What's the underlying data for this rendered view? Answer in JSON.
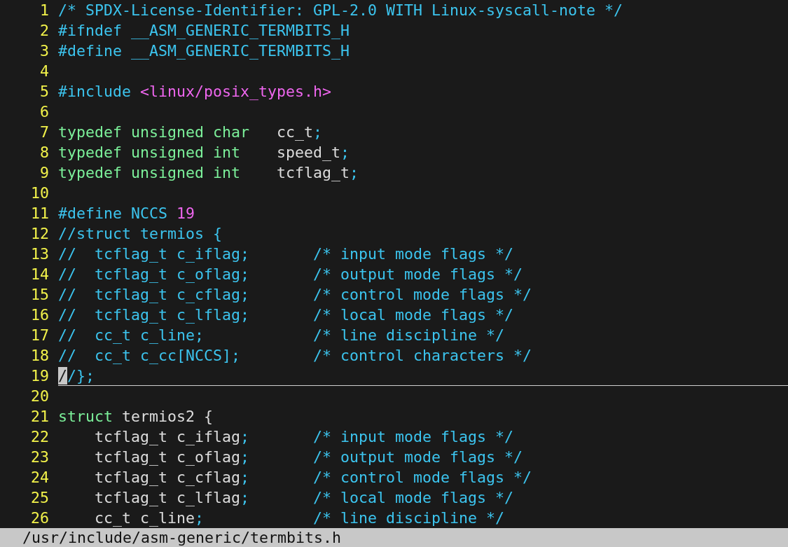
{
  "editor": {
    "lines": [
      {
        "number": "1",
        "current": false,
        "tokens": [
          {
            "kind": "comment",
            "text": "/* SPDX-License-Identifier: GPL-2.0 WITH Linux-syscall-note */"
          }
        ]
      },
      {
        "number": "2",
        "current": false,
        "tokens": [
          {
            "kind": "preproc",
            "text": "#ifndef __ASM_GENERIC_TERMBITS_H"
          }
        ]
      },
      {
        "number": "3",
        "current": false,
        "tokens": [
          {
            "kind": "preproc",
            "text": "#define __ASM_GENERIC_TERMBITS_H"
          }
        ]
      },
      {
        "number": "4",
        "current": false
      },
      {
        "number": "5",
        "current": false,
        "tokens": [
          {
            "kind": "preproc",
            "text": "#include "
          },
          {
            "kind": "string",
            "text": "<linux/posix_types.h>"
          }
        ]
      },
      {
        "number": "6",
        "current": false
      },
      {
        "number": "7",
        "current": false,
        "tokens": [
          {
            "kind": "type",
            "text": "typedef unsigned char"
          },
          {
            "kind": "plain",
            "text": "   cc_t"
          },
          {
            "kind": "punct",
            "text": ";"
          }
        ]
      },
      {
        "number": "8",
        "current": false,
        "tokens": [
          {
            "kind": "type",
            "text": "typedef unsigned int"
          },
          {
            "kind": "plain",
            "text": "    speed_t"
          },
          {
            "kind": "punct",
            "text": ";"
          }
        ]
      },
      {
        "number": "9",
        "current": false,
        "tokens": [
          {
            "kind": "type",
            "text": "typedef unsigned int"
          },
          {
            "kind": "plain",
            "text": "    tcflag_t"
          },
          {
            "kind": "punct",
            "text": ";"
          }
        ]
      },
      {
        "number": "10",
        "current": false
      },
      {
        "number": "11",
        "current": false,
        "tokens": [
          {
            "kind": "preproc",
            "text": "#define NCCS "
          },
          {
            "kind": "number",
            "text": "19"
          }
        ]
      },
      {
        "number": "12",
        "current": false,
        "tokens": [
          {
            "kind": "comment",
            "text": "//struct termios {"
          }
        ]
      },
      {
        "number": "13",
        "current": false,
        "tokens": [
          {
            "kind": "comment",
            "text": "//  tcflag_t c_iflag;       /* input mode flags */"
          }
        ]
      },
      {
        "number": "14",
        "current": false,
        "tokens": [
          {
            "kind": "comment",
            "text": "//  tcflag_t c_oflag;       /* output mode flags */"
          }
        ]
      },
      {
        "number": "15",
        "current": false,
        "tokens": [
          {
            "kind": "comment",
            "text": "//  tcflag_t c_cflag;       /* control mode flags */"
          }
        ]
      },
      {
        "number": "16",
        "current": false,
        "tokens": [
          {
            "kind": "comment",
            "text": "//  tcflag_t c_lflag;       /* local mode flags */"
          }
        ]
      },
      {
        "number": "17",
        "current": false,
        "tokens": [
          {
            "kind": "comment",
            "text": "//  cc_t c_line;            /* line discipline */"
          }
        ]
      },
      {
        "number": "18",
        "current": false,
        "tokens": [
          {
            "kind": "comment",
            "text": "//  cc_t c_cc[NCCS];        /* control characters */"
          }
        ]
      },
      {
        "number": "19",
        "current": true,
        "tokens": [
          {
            "kind": "cursor",
            "text": "/"
          },
          {
            "kind": "comment",
            "text": "/};"
          }
        ]
      },
      {
        "number": "20",
        "current": false
      },
      {
        "number": "21",
        "current": false,
        "tokens": [
          {
            "kind": "type",
            "text": "struct"
          },
          {
            "kind": "plain",
            "text": " termios2 {"
          }
        ]
      },
      {
        "number": "22",
        "current": false,
        "tokens": [
          {
            "kind": "plain",
            "text": "    tcflag_t c_iflag"
          },
          {
            "kind": "punct",
            "text": ";"
          },
          {
            "kind": "comment",
            "text": "       /* input mode flags */"
          }
        ]
      },
      {
        "number": "23",
        "current": false,
        "tokens": [
          {
            "kind": "plain",
            "text": "    tcflag_t c_oflag"
          },
          {
            "kind": "punct",
            "text": ";"
          },
          {
            "kind": "comment",
            "text": "       /* output mode flags */"
          }
        ]
      },
      {
        "number": "24",
        "current": false,
        "tokens": [
          {
            "kind": "plain",
            "text": "    tcflag_t c_cflag"
          },
          {
            "kind": "punct",
            "text": ";"
          },
          {
            "kind": "comment",
            "text": "       /* control mode flags */"
          }
        ]
      },
      {
        "number": "25",
        "current": false,
        "tokens": [
          {
            "kind": "plain",
            "text": "    tcflag_t c_lflag"
          },
          {
            "kind": "punct",
            "text": ";"
          },
          {
            "kind": "comment",
            "text": "       /* local mode flags */"
          }
        ]
      },
      {
        "number": "26",
        "current": false,
        "tokens": [
          {
            "kind": "plain",
            "text": "    cc_t c_line"
          },
          {
            "kind": "punct",
            "text": ";"
          },
          {
            "kind": "comment",
            "text": "            /* line discipline */"
          }
        ]
      }
    ]
  },
  "status_bar": {
    "file_path": "/usr/include/asm-generic/termbits.h"
  }
}
